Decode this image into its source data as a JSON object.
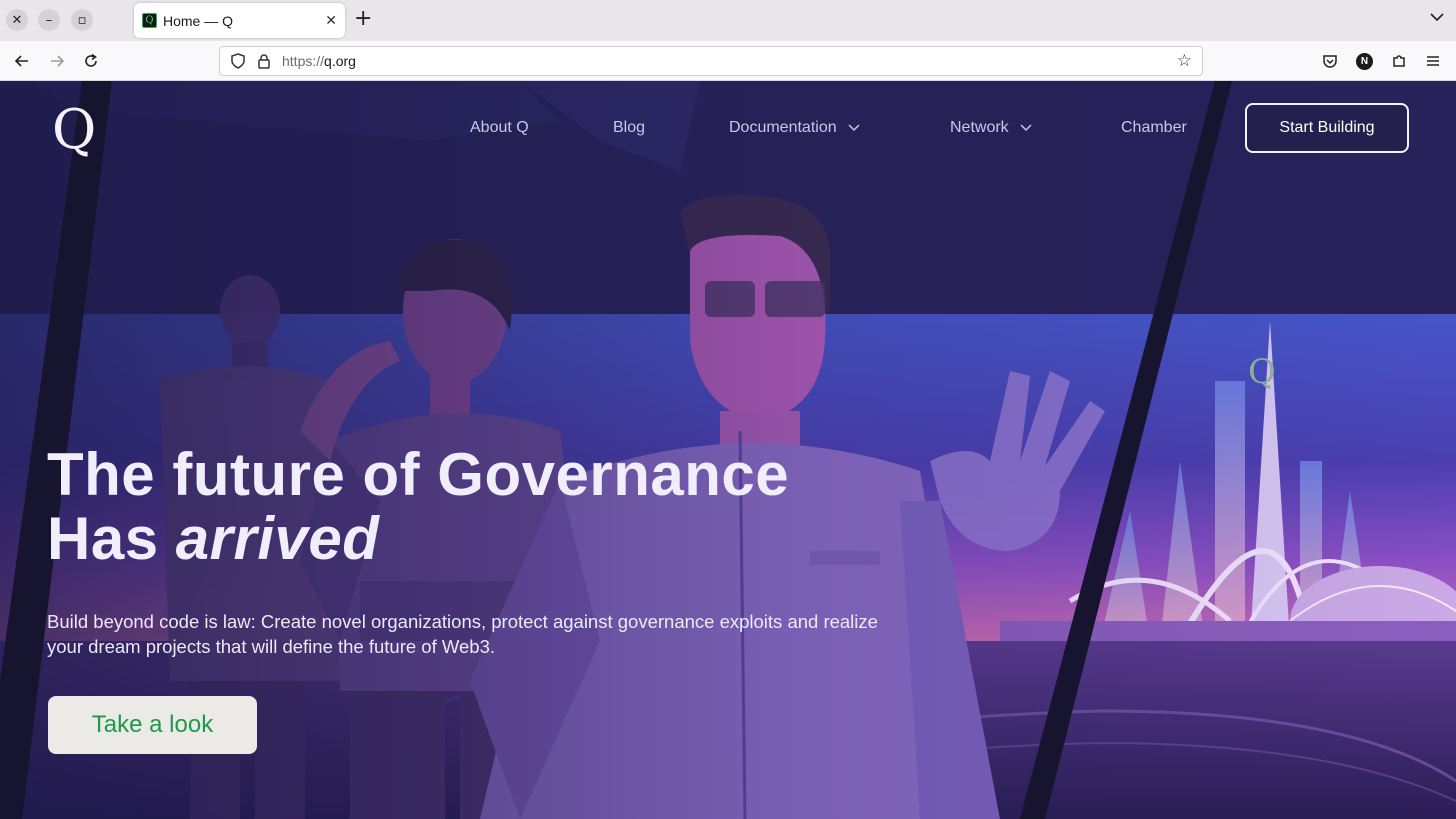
{
  "browser": {
    "tab_title": "Home — Q",
    "favicon_letter": "Q",
    "url_protocol": "https://",
    "url_host": "q.org",
    "profile_initial": "N",
    "icons": [
      "close-window-icon",
      "minimize-icon",
      "maximize-icon",
      "tab-close-icon",
      "new-tab-icon",
      "tab-list-chevron-icon",
      "back-arrow-icon",
      "forward-arrow-icon",
      "reload-icon",
      "shield-icon",
      "lock-icon",
      "bookmark-star-icon",
      "pocket-icon",
      "extensions-puzzle-icon",
      "hamburger-menu-icon"
    ]
  },
  "site": {
    "logo": "Q",
    "nav": [
      {
        "label": "About Q"
      },
      {
        "label": "Blog"
      },
      {
        "label": "Documentation"
      },
      {
        "label": "Network"
      },
      {
        "label": "Chamber"
      }
    ],
    "start_building": "Start Building"
  },
  "hero": {
    "title_regular": "The future of ",
    "title_bold": "Governance",
    "title_line2_regular": "Has ",
    "title_line2_italic": "arrived",
    "subtitle": "Build beyond code is law: Create novel organizations, protect against governance exploits and realize your dream projects that will define the future of Web3.",
    "cta": "Take a look",
    "tower_logo": "Q"
  },
  "colors": {
    "accent_green": "#1f9a4a",
    "hero_dark": "#232050",
    "hero_purple": "#5a3e9e"
  }
}
